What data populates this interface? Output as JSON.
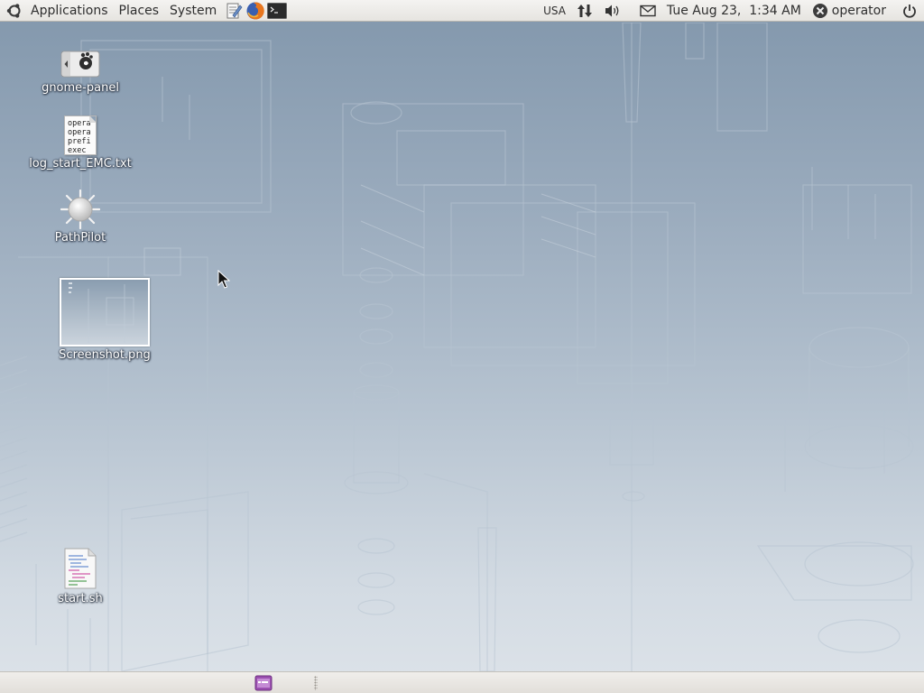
{
  "top_panel": {
    "menus": {
      "applications": "Applications",
      "places": "Places",
      "system": "System"
    },
    "launchers": [
      "text-editor-icon",
      "firefox-icon",
      "terminal-icon"
    ],
    "tray": {
      "keyboard_layout": "USA",
      "clock": "Tue Aug 23,  1:34 AM",
      "user": "operator"
    }
  },
  "desktop": {
    "icons": [
      {
        "label": "gnome-panel",
        "icon": "gnome-panel-icon"
      },
      {
        "label": "log_start_EMC.txt",
        "icon": "text-file-icon",
        "preview_lines": [
          "opera",
          "opera",
          "prefi",
          "exec"
        ]
      },
      {
        "label": "PathPilot",
        "icon": "pathpilot-icon"
      },
      {
        "label": "Screenshot.png",
        "icon": "image-thumbnail"
      },
      {
        "label": "start.sh",
        "icon": "script-file-icon"
      }
    ]
  },
  "colors": {
    "panel_bg": "#e9e7e3",
    "desktop_top": "#8297ac",
    "desktop_bottom": "#dde3e9",
    "label_text": "#ffffff"
  }
}
